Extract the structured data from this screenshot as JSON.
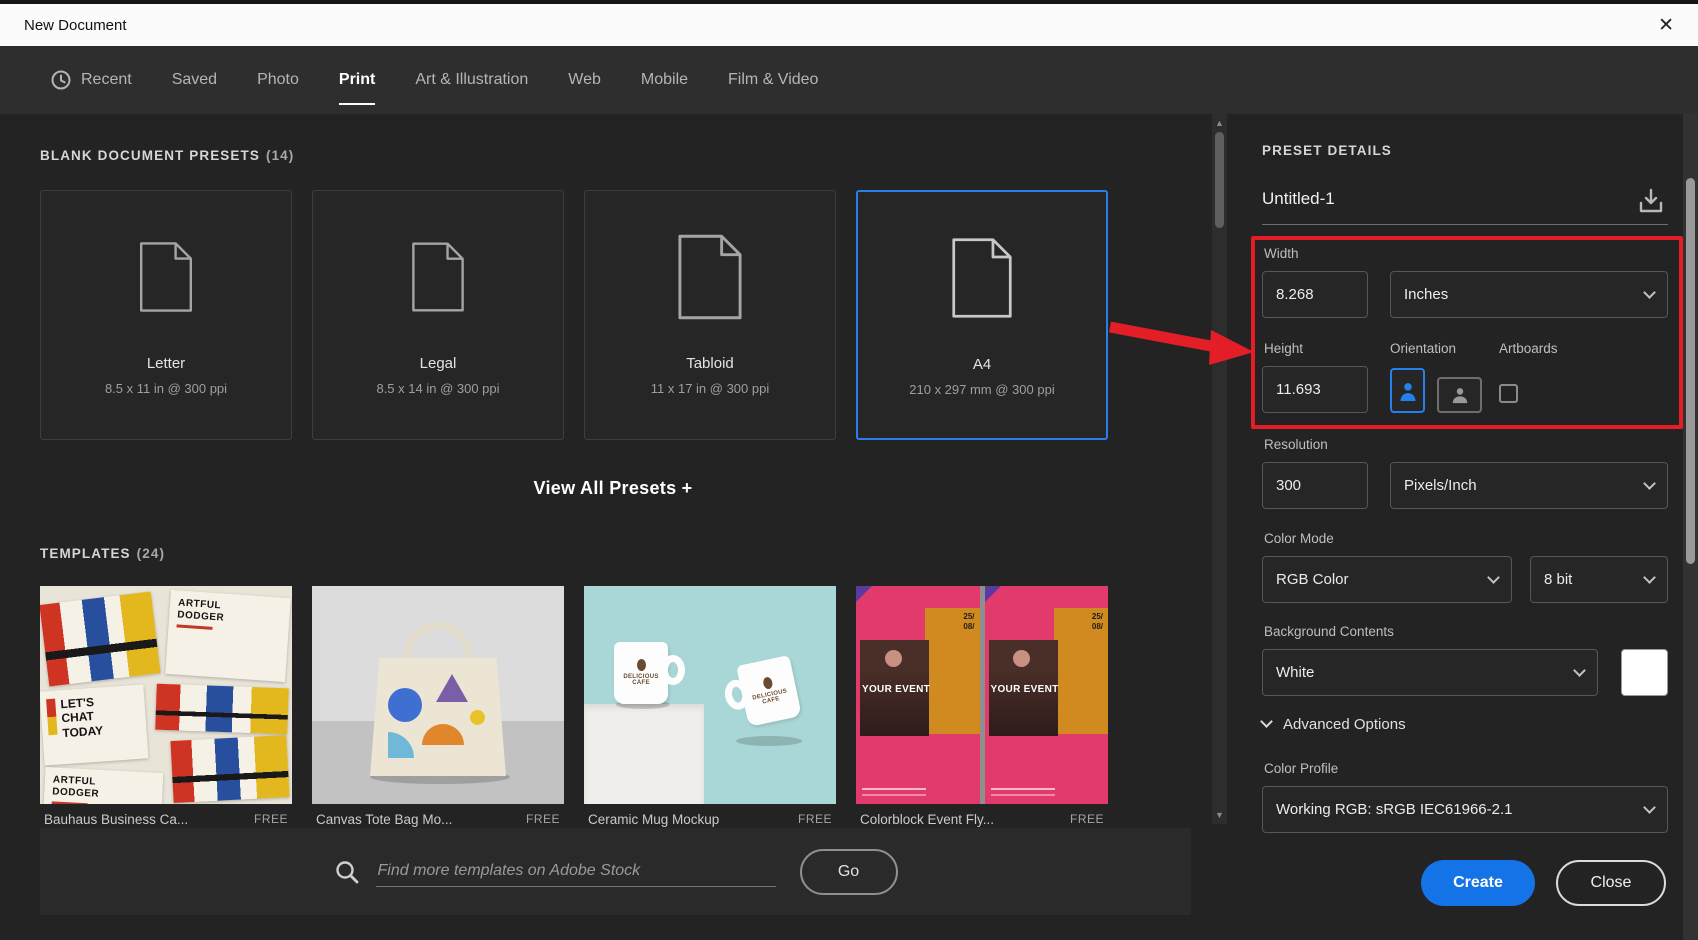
{
  "window": {
    "title": "New Document"
  },
  "icons": {
    "close": "✕",
    "scroll_up": "▲",
    "scroll_down": "▼"
  },
  "tabs": {
    "items": [
      {
        "label": "Recent"
      },
      {
        "label": "Saved"
      },
      {
        "label": "Photo"
      },
      {
        "label": "Print"
      },
      {
        "label": "Art & Illustration"
      },
      {
        "label": "Web"
      },
      {
        "label": "Mobile"
      },
      {
        "label": "Film & Video"
      }
    ],
    "active": "Print"
  },
  "presets": {
    "heading": "BLANK DOCUMENT PRESETS",
    "count": "(14)",
    "view_all_label": "View All Presets +",
    "selected": "A4",
    "items": [
      {
        "name": "Letter",
        "size": "8.5 x 11 in @ 300 ppi"
      },
      {
        "name": "Legal",
        "size": "8.5 x 14 in @ 300 ppi"
      },
      {
        "name": "Tabloid",
        "size": "11 x 17 in @ 300 ppi"
      },
      {
        "name": "A4",
        "size": "210 x 297 mm @ 300 ppi"
      }
    ]
  },
  "templates": {
    "heading": "TEMPLATES",
    "count": "(24)",
    "items": [
      {
        "name": "Bauhaus Business Ca...",
        "badge": "FREE",
        "art_title": "ARTFUL DODGER",
        "art_alt": "LET'S CHAT TODAY"
      },
      {
        "name": "Canvas Tote Bag Mo...",
        "badge": "FREE"
      },
      {
        "name": "Ceramic Mug Mockup",
        "badge": "FREE",
        "art_title": "DELICIOUS CAFE"
      },
      {
        "name": "Colorblock Event Fly...",
        "badge": "FREE",
        "art_title": "YOUR EVENT",
        "art_date": "25/\n08/"
      }
    ]
  },
  "search": {
    "placeholder": "Find more templates on Adobe Stock",
    "go_label": "Go"
  },
  "details": {
    "heading": "PRESET DETAILS",
    "doc_name": "Untitled-1",
    "width": {
      "label": "Width",
      "value": "8.268",
      "unit": "Inches"
    },
    "height": {
      "label": "Height",
      "value": "11.693"
    },
    "orientation_label": "Orientation",
    "artboards_label": "Artboards",
    "resolution": {
      "label": "Resolution",
      "value": "300",
      "unit": "Pixels/Inch"
    },
    "color_mode": {
      "label": "Color Mode",
      "value": "RGB Color",
      "bit_depth": "8 bit"
    },
    "background": {
      "label": "Background Contents",
      "value": "White"
    },
    "advanced_label": "Advanced Options",
    "color_profile": {
      "label": "Color Profile",
      "value": "Working RGB: sRGB IEC61966-2.1"
    },
    "create_label": "Create",
    "close_label": "Close"
  },
  "colors": {
    "accent_blue": "#1473e6",
    "selection_blue": "#2680eb",
    "annotation_red": "#e41e26"
  }
}
